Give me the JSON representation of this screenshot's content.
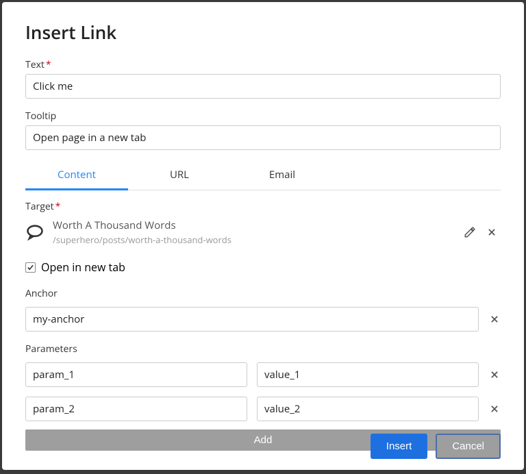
{
  "dialog": {
    "title": "Insert Link"
  },
  "text_field": {
    "label": "Text",
    "value": "Click me"
  },
  "tooltip_field": {
    "label": "Tooltip",
    "value": "Open page in a new tab"
  },
  "tabs": {
    "content": "Content",
    "url": "URL",
    "email": "Email",
    "active": "content"
  },
  "target": {
    "label": "Target",
    "title": "Worth A Thousand Words",
    "path": "/superhero/posts/worth-a-thousand-words"
  },
  "open_new_tab": {
    "label": "Open in new tab",
    "checked": true
  },
  "anchor": {
    "label": "Anchor",
    "value": "my-anchor"
  },
  "parameters": {
    "label": "Parameters",
    "rows": [
      {
        "name": "param_1",
        "value": "value_1"
      },
      {
        "name": "param_2",
        "value": "value_2"
      }
    ],
    "add_label": "Add"
  },
  "footer": {
    "insert": "Insert",
    "cancel": "Cancel"
  },
  "required_marker": "*"
}
